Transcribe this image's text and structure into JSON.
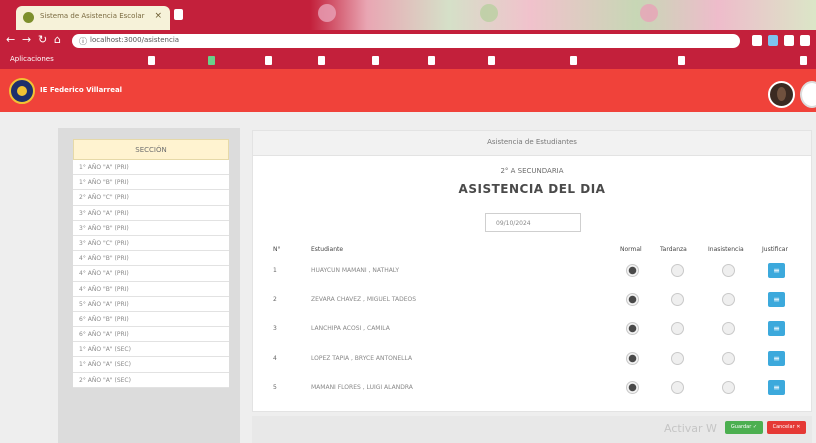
{
  "browser": {
    "tab_title": "Sistema de Asistencia Escolar",
    "tab_close": "×",
    "url": "localhost:3000/asistencia",
    "bookmarks_label": "Aplicaciones"
  },
  "app": {
    "brand": "IE Federico Villarreal"
  },
  "sidebar": {
    "header": "SECCIÓN",
    "items": [
      "1° AÑO \"A\" (PRI)",
      "1° AÑO \"B\" (PRI)",
      "2° AÑO \"C\" (PRI)",
      "3° AÑO \"A\" (PRI)",
      "3° AÑO \"B\" (PRI)",
      "3° AÑO \"C\" (PRI)",
      "4° AÑO \"B\" (PRI)",
      "4° AÑO \"A\" (PRI)",
      "4° AÑO \"B\" (PRI)",
      "5° AÑO \"A\" (PRI)",
      "6° AÑO \"B\" (PRI)",
      "6° AÑO \"A\" (PRI)",
      "1° AÑO \"A\" (SEC)",
      "1° AÑO \"A\" (SEC)",
      "2° AÑO \"A\" (SEC)"
    ]
  },
  "card": {
    "title": "Asistencia de Estudiantes",
    "grade": "2° A SECUNDARIA",
    "heading": "ASISTENCIA DEL DIA",
    "date": "09/10/2024"
  },
  "table": {
    "headers": {
      "num": "N°",
      "student": "Estudiante",
      "normal": "Normal",
      "tardanza": "Tardanza",
      "inasistencia": "Inasistencia",
      "justificar": "Justificar"
    },
    "rows": [
      {
        "num": "1",
        "name": "HUAYCUN MAMANI , NATHALY"
      },
      {
        "num": "2",
        "name": "ZEVARA CHAVEZ , MIGUEL TADEOS"
      },
      {
        "num": "3",
        "name": "LANCHIPA ACOSI , CAMILA"
      },
      {
        "num": "4",
        "name": "LOPEZ TAPIA , BRYCE ANTONELLA"
      },
      {
        "num": "5",
        "name": "MAMANI FLORES , LUIGI ALANDRA"
      }
    ],
    "justify_glyph": "≡"
  },
  "footer": {
    "watermark": "Activar W",
    "save_label": "Guardar ✓",
    "cancel_label": "Cancelar ✕"
  }
}
